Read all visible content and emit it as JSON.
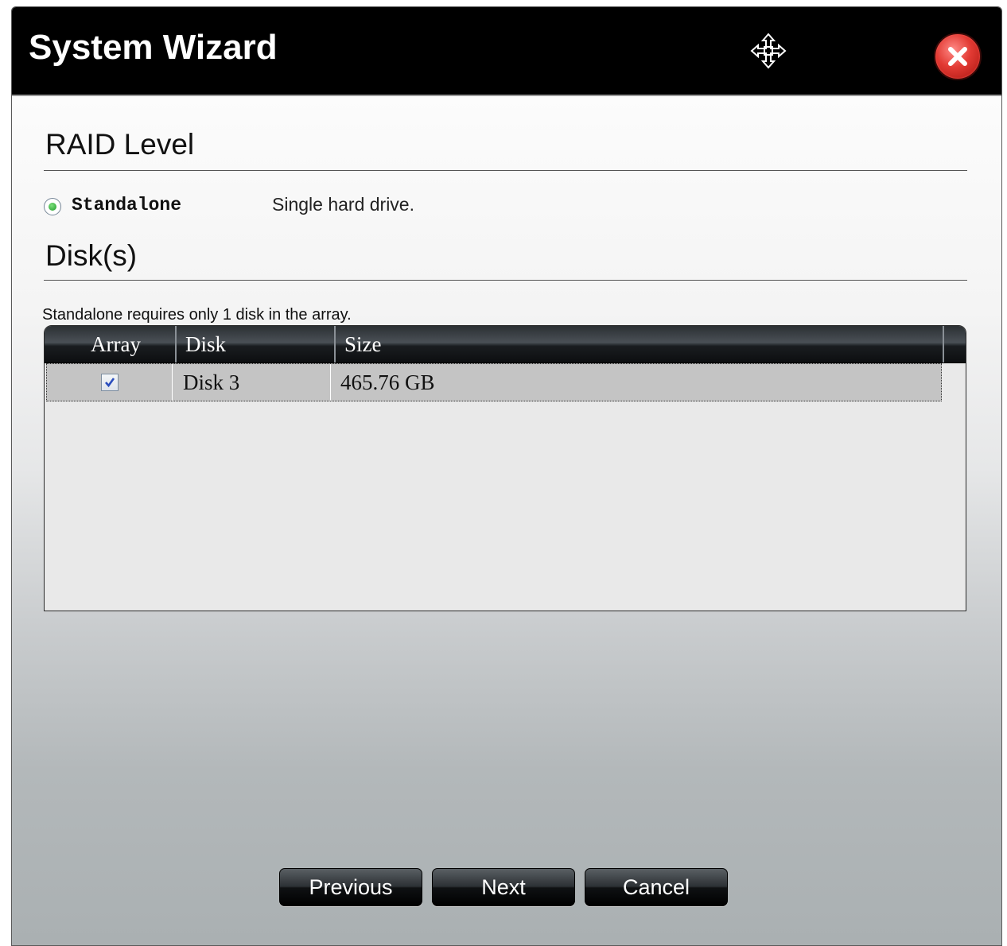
{
  "window": {
    "title": "System Wizard"
  },
  "icons": {
    "move": "move-icon",
    "close": "close-icon"
  },
  "raid": {
    "heading": "RAID Level",
    "option": {
      "label": "Standalone",
      "description": "Single hard drive.",
      "selected": true
    }
  },
  "disks": {
    "heading": "Disk(s)",
    "hint": "Standalone requires only 1 disk in the array.",
    "columns": [
      "Array",
      "Disk",
      "Size"
    ],
    "rows": [
      {
        "array_checked": true,
        "disk": "Disk 3",
        "size": "465.76 GB"
      }
    ]
  },
  "buttons": {
    "previous": "Previous",
    "next": "Next",
    "cancel": "Cancel"
  },
  "colors": {
    "titlebar": "#000000",
    "close": "#e23a33",
    "selected_row": "#c4c4c4",
    "radio_dot": "#1f9a2a"
  }
}
